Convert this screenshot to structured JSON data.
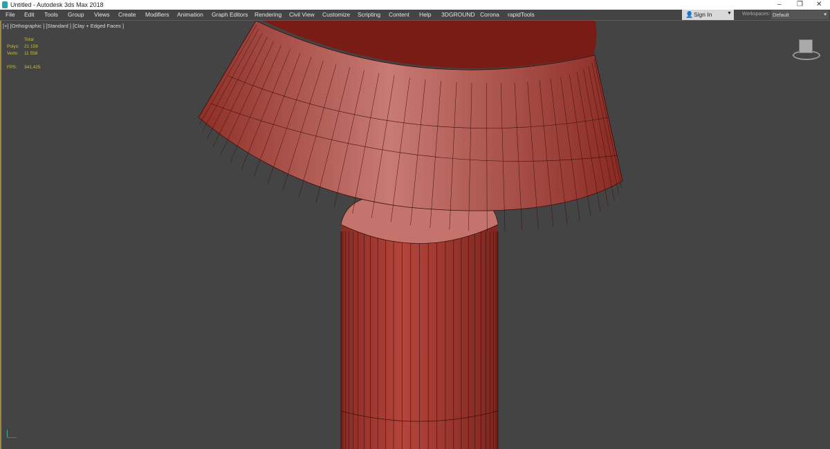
{
  "window": {
    "title": "Untitled - Autodesk 3ds Max 2018",
    "minimize": "–",
    "restore": "❐",
    "close": "✕"
  },
  "menu": [
    "File",
    "Edit",
    "Tools",
    "Group",
    "Views",
    "Create",
    "Modifiers",
    "Animation",
    "Graph Editors",
    "Rendering",
    "Civil View",
    "Customize",
    "Scripting",
    "Content",
    "Help",
    "3DGROUND",
    "Corona",
    "rapidTools"
  ],
  "signin": {
    "label": "Sign In",
    "arrow": "▼"
  },
  "workspaces": {
    "label": "Workspaces:",
    "value": "Default",
    "arrow": "▾"
  },
  "viewport": {
    "label": "[+] [Orthographic ] [Standard ] [Clay + Edged Faces ]"
  },
  "stats": {
    "header": "Total",
    "polys_label": "Polys:",
    "polys": "21 158",
    "verts_label": "Verts:",
    "verts": "11 558",
    "fps_label": "FPS:",
    "fps": "341,425"
  },
  "colors": {
    "mesh": "#b0463e",
    "viewport": "#444444",
    "accent": "#c8c040"
  }
}
